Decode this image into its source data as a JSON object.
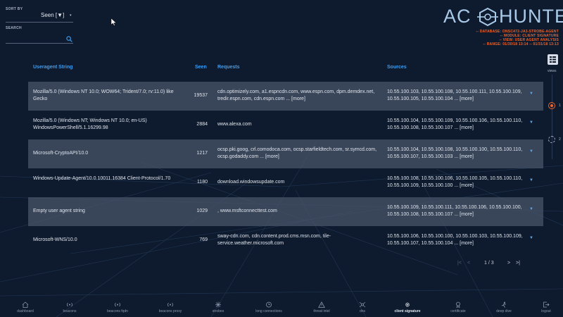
{
  "sort": {
    "label": "SORT BY",
    "value": "Seen [▼]",
    "caret": "▾"
  },
  "search": {
    "label": "SEARCH",
    "value": "",
    "placeholder": ""
  },
  "logo": {
    "left": "AC",
    "right": "HUNTER"
  },
  "info": [
    "-- DATABASE: ONSC472-JA3-STROBE-AGENT",
    "-- MODULE: CLIENT SIGNATURE",
    "-- VIEW: USER AGENT ANALYSIS",
    "-- RANGE: 01/30/18 13:14 -- 01/31/18 13:13"
  ],
  "views": {
    "label": "views",
    "view1": "1",
    "view2": "2"
  },
  "table": {
    "headers": {
      "ua": "Useragent String",
      "seen": "Seen",
      "requests": "Requests",
      "sources": "Sources"
    },
    "rows": [
      {
        "ua": "Mozilla/5.0 (Windows NT 10.0; WOW64; Trident/7.0; rv:11.0) like Gecko",
        "seen": "19537",
        "requests": "cdn.optimizely.com, a1.espncdn.com, www.espn.com, dpm.demdex.net, tredir.espn.com, cdn.espn.com ... [more]",
        "sources": "10.55.100.103, 10.55.100.108, 10.55.100.111, 10.55.100.109, 10.55.100.105, 10.55.100.104 ... [more]"
      },
      {
        "ua": "Mozilla/5.0 (Windows NT; Windows NT 10.0; en-US) WindowsPowerShell/5.1.16299.98",
        "seen": "2884",
        "requests": "www.alexa.com",
        "sources": "10.55.100.104, 10.55.100.109, 10.55.100.106, 10.55.100.110, 10.55.100.108, 10.55.100.107 ... [more]"
      },
      {
        "ua": "Microsoft-CryptoAPI/10.0",
        "seen": "1217",
        "requests": "ocsp.pki.goog, crl.comodoca.com, ocsp.starfieldtech.com, sr.symcd.com, ocsp.godaddy.com ... [more]",
        "sources": "10.55.100.104, 10.55.100.108, 10.55.100.100, 10.55.100.110, 10.55.100.107, 10.55.100.103 ... [more]"
      },
      {
        "ua": "Windows-Update-Agent/10.0.10011.16384 Client-Protocol/1.70",
        "seen": "1180",
        "requests": "download.windowsupdate.com",
        "sources": "10.55.100.108, 10.55.100.106, 10.55.100.105, 10.55.100.110, 10.55.100.109, 10.55.100.100 ... [more]"
      },
      {
        "ua": "Empty user agent string",
        "seen": "1029",
        "requests": ", www.msftconnecttest.com",
        "sources": "10.55.100.109, 10.55.100.111, 10.55.100.106, 10.55.100.100, 10.55.100.108, 10.55.100.107 ... [more]"
      },
      {
        "ua": "Microsoft-WNS/10.0",
        "seen": "769",
        "requests": "sway-cdn.com, cdn.content.prod.cms.msn.com, tile-service.weather.microsoft.com",
        "sources": "10.55.100.106, 10.55.100.100, 10.55.100.103, 10.55.100.109, 10.55.100.107, 10.55.100.104 ... [more]"
      }
    ]
  },
  "pager": {
    "first": "|<",
    "prev": "<",
    "page": "1 / 3",
    "next": ">",
    "last": ">|"
  },
  "nav": [
    {
      "label": "dashboard",
      "icon": "house-icon"
    },
    {
      "label": "beacons",
      "icon": "beacon-icon"
    },
    {
      "label": "beacons fqdn",
      "icon": "beacon-fqdn-icon"
    },
    {
      "label": "beacons proxy",
      "icon": "beacon-proxy-icon"
    },
    {
      "label": "strobes",
      "icon": "strobe-icon"
    },
    {
      "label": "long connections",
      "icon": "long-connections-icon"
    },
    {
      "label": "threat intel",
      "icon": "warning-icon"
    },
    {
      "label": "dns",
      "icon": "dns-icon"
    },
    {
      "label": "client signature",
      "icon": "gear-icon"
    },
    {
      "label": "certificate",
      "icon": "certificate-icon"
    },
    {
      "label": "deep dive",
      "icon": "diver-icon"
    },
    {
      "label": "logout",
      "icon": "logout-icon"
    }
  ],
  "colors": {
    "background": "#0e1a2d",
    "accent": "#3c9ff5",
    "warning": "#f0652a",
    "row_alt": "#485468"
  }
}
